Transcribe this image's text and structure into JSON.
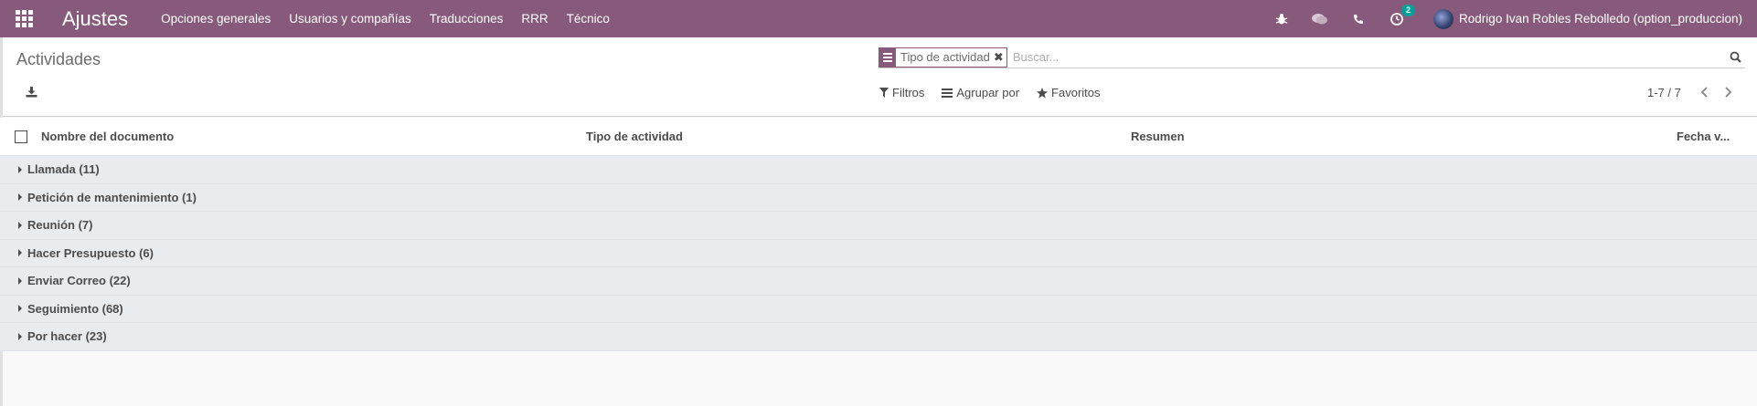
{
  "navbar": {
    "app_title": "Ajustes",
    "menu": [
      "Opciones generales",
      "Usuarios y compañías",
      "Traducciones",
      "RRR",
      "Técnico"
    ],
    "activity_count": "2",
    "user_name": "Rodrigo Ivan Robles Rebolledo (option_produccion)",
    "icons": [
      "apps-icon",
      "bug-icon",
      "chat-icon",
      "phone-icon",
      "activity-clock-icon"
    ]
  },
  "control_panel": {
    "breadcrumb": "Actividades",
    "search": {
      "facet_value": "Tipo de actividad",
      "placeholder": "Buscar..."
    },
    "filters": {
      "filters_label": "Filtros",
      "group_by_label": "Agrupar por",
      "favorites_label": "Favoritos"
    },
    "pager": "1-7 / 7"
  },
  "list": {
    "columns": [
      "Nombre del documento",
      "Tipo de actividad",
      "Resumen",
      "Fecha v..."
    ],
    "groups": [
      "Llamada (11)",
      "Petición de mantenimiento (1)",
      "Reunión (7)",
      "Hacer Presupuesto (6)",
      "Enviar Correo (22)",
      "Seguimiento (68)",
      "Por hacer (23)"
    ]
  },
  "colors": {
    "brand": "#875a7b",
    "badge": "#00a09d",
    "group_row": "#e9ecef"
  }
}
